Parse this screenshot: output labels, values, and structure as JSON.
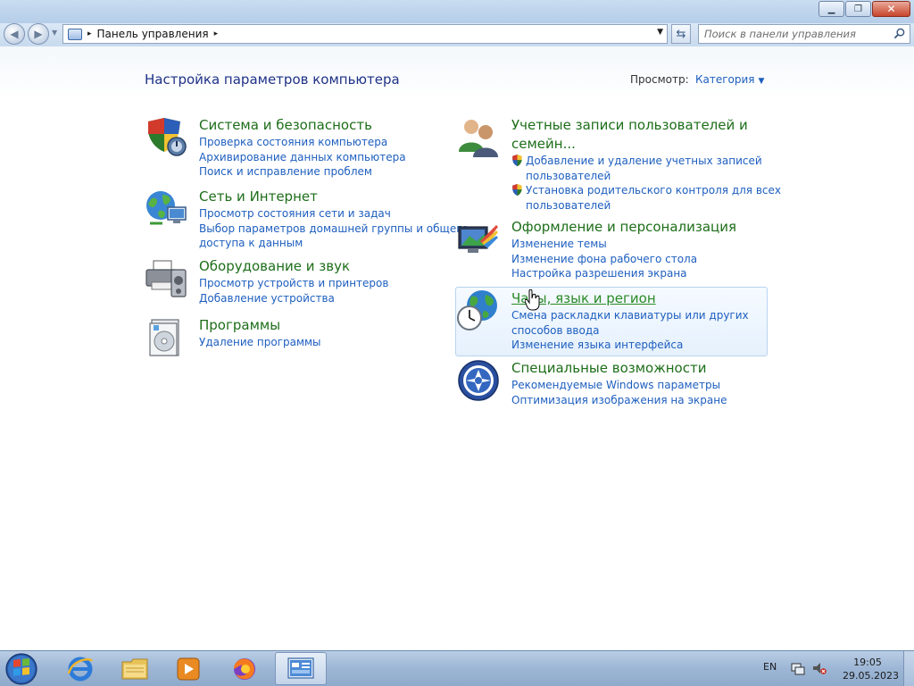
{
  "window": {
    "minimize_glyph": "▁",
    "maximize_glyph": "❐",
    "close_glyph": "✕"
  },
  "navbar": {
    "back_glyph": "◀",
    "forward_glyph": "▶",
    "breadcrumb_sep": "▸",
    "breadcrumb": "Панель управления",
    "breadcrumb_after": "▸",
    "refresh_glyph": "⇆",
    "search_placeholder": "Поиск в панели управления"
  },
  "header": {
    "title": "Настройка параметров компьютера",
    "view_label": "Просмотр:",
    "view_value": "Категория",
    "view_caret": "▼"
  },
  "categories_left": [
    {
      "title": "Система и безопасность",
      "icon": "shield-icon",
      "links": [
        "Проверка состояния компьютера",
        "Архивирование данных компьютера",
        "Поиск и исправление проблем"
      ]
    },
    {
      "title": "Сеть и Интернет",
      "icon": "network-globe-icon",
      "links": [
        "Просмотр состояния сети и задач",
        "Выбор параметров домашней группы и общего",
        "доступа к данным"
      ]
    },
    {
      "title": "Оборудование и звук",
      "icon": "printer-icon",
      "links": [
        "Просмотр устройств и принтеров",
        "Добавление устройства"
      ]
    },
    {
      "title": "Программы",
      "icon": "programs-icon",
      "links": [
        "Удаление программы"
      ]
    }
  ],
  "categories_right": [
    {
      "title_line1": "Учетные записи пользователей и",
      "title_line2": "семейн...",
      "icon": "users-icon",
      "links": [
        {
          "line1": "Добавление и удаление учетных записей",
          "line2": "пользователей"
        },
        {
          "line1": "Установка родительского контроля для всех",
          "line2": "пользователей"
        }
      ]
    },
    {
      "title": "Оформление и персонализация",
      "icon": "appearance-icon",
      "links": [
        "Изменение темы",
        "Изменение фона рабочего стола",
        "Настройка разрешения экрана"
      ]
    },
    {
      "title": "Часы, язык и регион",
      "icon": "clock-globe-icon",
      "links": [
        "Смена раскладки клавиатуры или других",
        "способов ввода",
        "Изменение языка интерфейса"
      ]
    },
    {
      "title": "Специальные возможности",
      "icon": "accessibility-icon",
      "links": [
        "Рекомендуемые Windows параметры",
        "Оптимизация изображения на экране"
      ]
    }
  ],
  "taskbar": {
    "items": [
      "start-orb",
      "internet-explorer",
      "windows-explorer",
      "media-player",
      "firefox",
      "control-panel"
    ],
    "language": "EN",
    "time": "19:05",
    "date": "29.05.2023"
  },
  "colors": {
    "category_title": "#1d6e19",
    "link": "#1e5fbf",
    "page_title": "#1e3287"
  }
}
